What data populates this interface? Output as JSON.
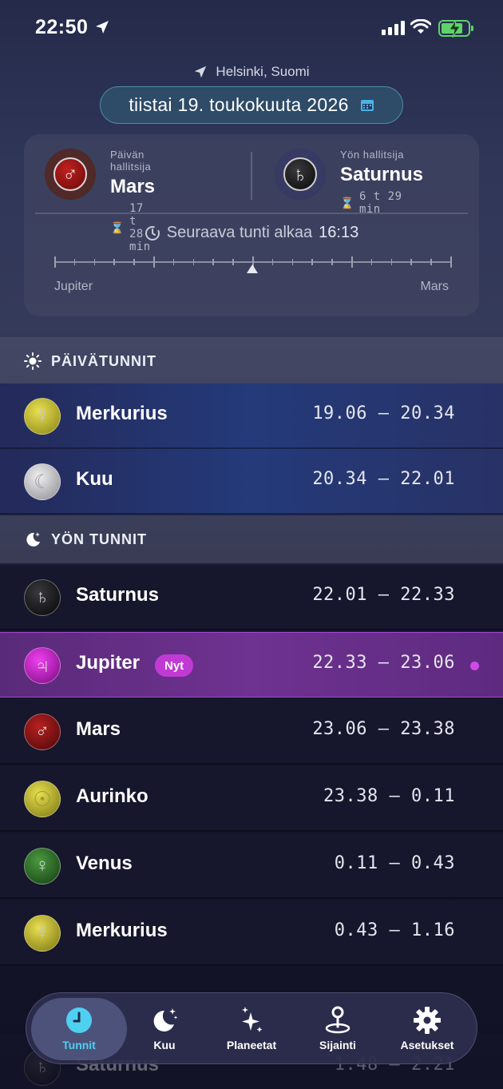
{
  "status_bar": {
    "time": "22:50"
  },
  "header": {
    "location": "Helsinki, Suomi",
    "date": "tiistai 19. toukokuuta 2026"
  },
  "rulers": {
    "day": {
      "caption": "Päivän hallitsija",
      "planet": "Mars",
      "duration": "17 t 28 min",
      "symbol": "♂"
    },
    "night": {
      "caption": "Yön hallitsija",
      "planet": "Saturnus",
      "duration": "6 t 29 min",
      "symbol": "♄"
    },
    "next_hour_label": "Seuraava tunti alkaa",
    "next_hour_time": "16:13",
    "scale_start": "Jupiter",
    "scale_end": "Mars",
    "scale_progress": 0.5
  },
  "day_section": {
    "title": "PÄIVÄTUNNIT",
    "rows": [
      {
        "planet": "Merkurius",
        "symbol": "☿",
        "time": "19.06 – 20.34"
      },
      {
        "planet": "Kuu",
        "symbol": "☾",
        "time": "20.34 – 22.01"
      }
    ]
  },
  "night_section": {
    "title": "YÖN TUNNIT",
    "now_badge": "Nyt",
    "rows": [
      {
        "planet": "Saturnus",
        "symbol": "♄",
        "time": "22.01 – 22.33"
      },
      {
        "planet": "Jupiter",
        "symbol": "♃",
        "time": "22.33 – 23.06"
      },
      {
        "planet": "Mars",
        "symbol": "♂",
        "time": "23.06 – 23.38"
      },
      {
        "planet": "Aurinko",
        "symbol": "☉",
        "time": "23.38 – 0.11"
      },
      {
        "planet": "Venus",
        "symbol": "♀",
        "time": "0.11 – 0.43"
      },
      {
        "planet": "Merkurius",
        "symbol": "☿",
        "time": "0.43 – 1.16"
      },
      {
        "planet": "Saturnus",
        "symbol": "♄",
        "time": "1.48 – 2.21"
      }
    ]
  },
  "tabs": [
    {
      "label": "Tunnit",
      "icon": "clock-icon",
      "active": true
    },
    {
      "label": "Kuu",
      "icon": "moon-stars-icon",
      "active": false
    },
    {
      "label": "Planeetat",
      "icon": "sparkles-icon",
      "active": false
    },
    {
      "label": "Sijainti",
      "icon": "location-pin-icon",
      "active": false
    },
    {
      "label": "Asetukset",
      "icon": "gear-icon",
      "active": false
    }
  ],
  "colors": {
    "accent": "#4fd0f0",
    "current_hour": "#c23ad4",
    "mercury": "#c9c43a",
    "moon": "#c8c8cc",
    "saturn": "#2a2a2e",
    "jupiter": "#c020c8",
    "mars": "#8a1a1a",
    "sun": "#c8c23a",
    "venus": "#2f6a2a"
  }
}
